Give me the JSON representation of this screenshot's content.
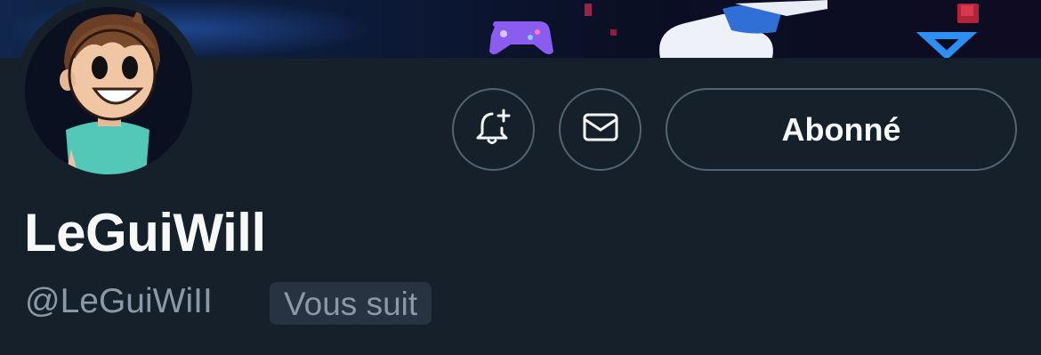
{
  "profile": {
    "display_name": "LeGuiWill",
    "handle": "@LeGuiWiII",
    "follows_you_badge": "Vous suit"
  },
  "actions": {
    "notify_icon": "bell-plus-icon",
    "message_icon": "envelope-icon",
    "follow_label": "Abonné"
  },
  "colors": {
    "background": "#15202b",
    "button_border": "#536471",
    "primary_text": "#f7f9f9",
    "secondary_text": "#8b98a5",
    "badge_background": "#273340"
  }
}
